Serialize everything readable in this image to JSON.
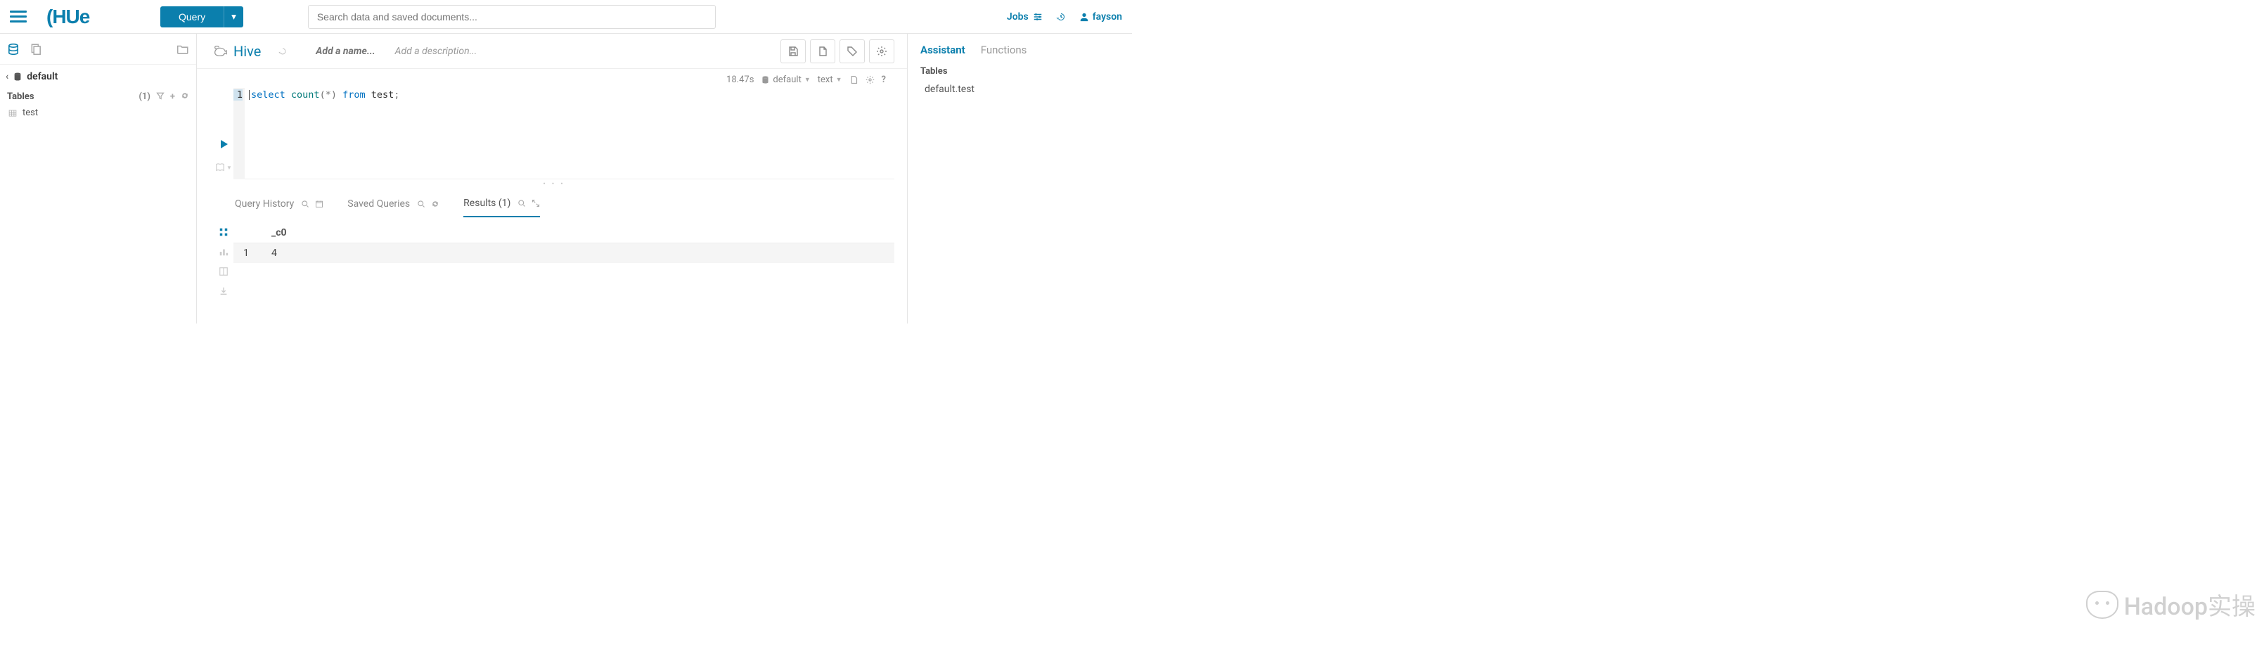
{
  "topbar": {
    "query_label": "Query",
    "search_placeholder": "Search data and saved documents...",
    "jobs_label": "Jobs",
    "username": "fayson"
  },
  "left": {
    "database": "default",
    "tables_label": "Tables",
    "tables_count": "(1)",
    "tables": [
      {
        "name": "test"
      }
    ]
  },
  "editor": {
    "engine": "Hive",
    "name_placeholder": "Add a name...",
    "desc_placeholder": "Add a description...",
    "status": {
      "elapsed": "18.47s",
      "database": "default",
      "type": "text"
    },
    "code_line_number": "1",
    "code": {
      "tok1": "select",
      "tok2": "count",
      "tok3": "(*)",
      "tok4": "from",
      "tok5": "test",
      "tok6": ";"
    }
  },
  "tabs": {
    "history": "Query History",
    "saved": "Saved Queries",
    "results": "Results (1)"
  },
  "results": {
    "columns": {
      "c0": "_c0"
    },
    "rows": [
      {
        "idx": "1",
        "c0": "4"
      }
    ]
  },
  "right": {
    "tab_assistant": "Assistant",
    "tab_functions": "Functions",
    "section_tables": "Tables",
    "items": [
      {
        "name": "default.test"
      }
    ]
  },
  "watermark": "Hadoop实操"
}
